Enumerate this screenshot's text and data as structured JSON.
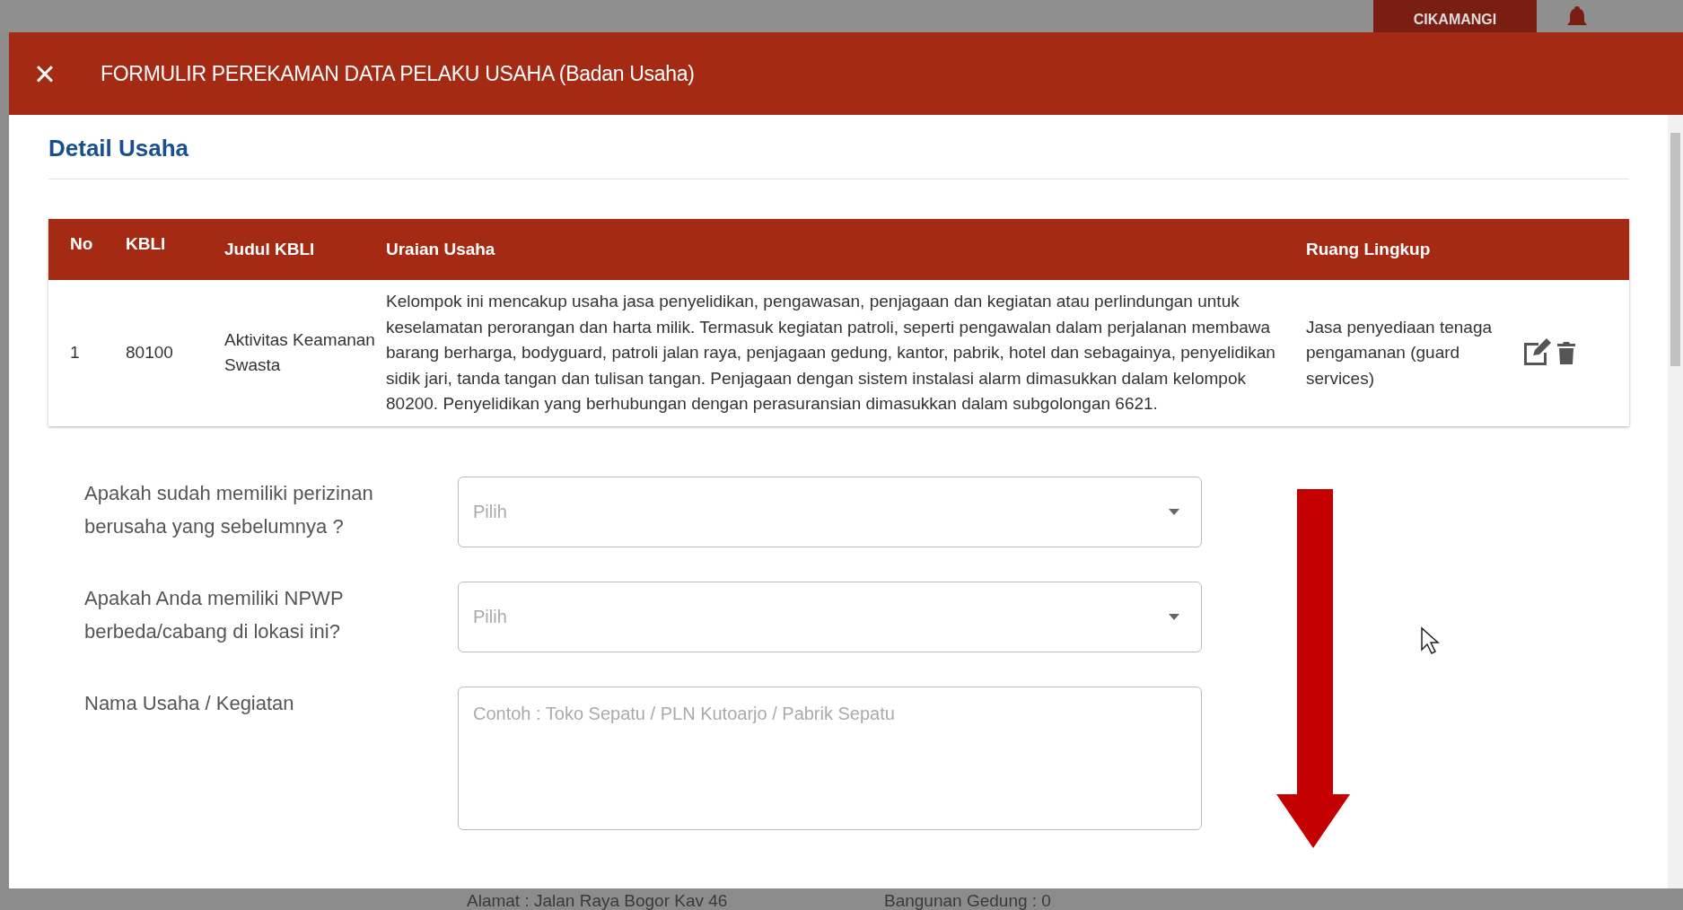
{
  "background_page": {
    "user_box": "CIKAMANGI",
    "bottom_texts": [
      "Alamat : Jalan Raya Bogor Kav 46",
      "Bangunan Gedung : 0"
    ]
  },
  "modal": {
    "title": "FORMULIR PEREKAMAN DATA PELAKU USAHA (Badan Usaha)",
    "close": "×",
    "section_title": "Detail Usaha",
    "table": {
      "columns": [
        "No",
        "KBLI",
        "Judul KBLI",
        "Uraian Usaha",
        "Ruang Lingkup"
      ],
      "rows": [
        {
          "no": "1",
          "kbli": "80100",
          "judul": "Aktivitas Keamanan Swasta",
          "uraian": "Kelompok ini mencakup usaha jasa penyelidikan, pengawasan, penjagaan dan kegiatan atau perlindungan untuk keselamatan perorangan dan harta milik. Termasuk kegiatan patroli, seperti pengawalan dalam perjalanan membawa barang berharga, bodyguard, patroli jalan raya, penjagaan gedung, kantor, pabrik, hotel dan sebagainya, penyelidikan sidik jari, tanda tangan dan tulisan tangan. Penjagaan dengan sistem instalasi alarm dimasukkan dalam kelompok 80200. Penyelidikan yang berhubungan dengan perasuransian dimasukkan dalam subgolongan 6621.",
          "ruang_lingkup": "Jasa penyediaan tenaga pengamanan (guard services)"
        }
      ]
    },
    "fields": [
      {
        "kind": "select",
        "label": "Apakah sudah memiliki perizinan berusaha yang sebelumnya ?",
        "placeholder": "Pilih"
      },
      {
        "kind": "select",
        "label": "Apakah Anda memiliki NPWP berbeda/cabang di lokasi ini?",
        "placeholder": "Pilih"
      },
      {
        "kind": "textarea",
        "label": "Nama Usaha / Kegiatan",
        "placeholder": "Contoh : Toko Sepatu / PLN Kutoarjo / Pabrik Sepatu"
      }
    ]
  }
}
